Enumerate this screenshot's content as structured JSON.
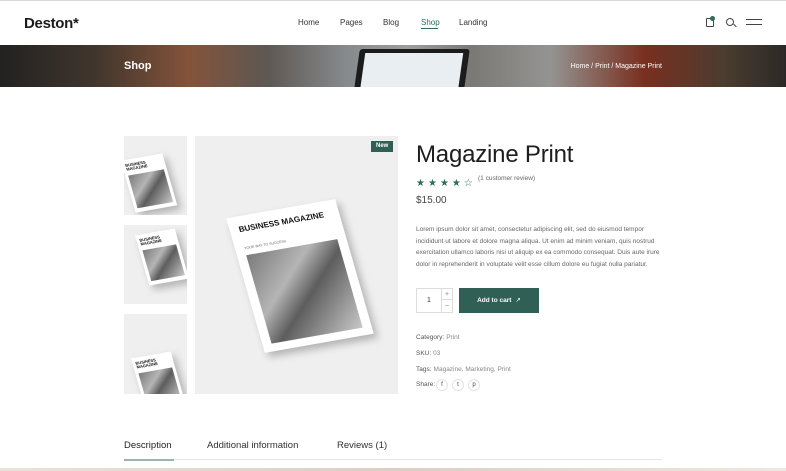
{
  "header": {
    "logo": "Deston*",
    "nav": [
      {
        "label": "Home"
      },
      {
        "label": "Pages"
      },
      {
        "label": "Blog"
      },
      {
        "label": "Shop",
        "active": true
      },
      {
        "label": "Landing"
      }
    ],
    "icons": [
      "bag-icon",
      "search-icon",
      "menu-icon"
    ]
  },
  "banner": {
    "title": "Shop",
    "breadcrumb": "Home / Print / Magazine Print"
  },
  "gallery": {
    "badge": "New",
    "cover_title": "BUSINESS MAGAZINE",
    "cover_subtitle": "YOUR WAY TO SUCCESS"
  },
  "product": {
    "title": "Magazine Print",
    "rating": 4,
    "rating_max": 5,
    "review_count": "(1 customer review)",
    "price": "$15.00",
    "description": "Lorem ipsum dolor sit amet, consectetur adipiscing elit, sed do eiusmod tempor incididunt ut labore et dolore magna aliqua. Ut enim ad minim veniam, quis nostrud exercitation ullamco laboris nisi ut aliquip ex ea commodo consequat. Duis aute irure dolor in reprehenderit in voluptate velit esse cillum dolore eu fugiat nulla pariatur.",
    "quantity": "1",
    "qty_plus": "+",
    "qty_minus": "–",
    "add_to_cart": "Add to cart",
    "add_to_cart_arrow": "↗",
    "category_label": "Category:",
    "category_value": "Print",
    "sku_label": "SKU:",
    "sku_value": "03",
    "tags_label": "Tags:",
    "tags_value": "Magazine, Marketing, Print",
    "share_label": "Share:",
    "share_icons": [
      "f",
      "t",
      "p"
    ]
  },
  "tabs": [
    {
      "label": "Description",
      "active": true
    },
    {
      "label": "Additional information"
    },
    {
      "label": "Reviews (1)"
    }
  ],
  "colors": {
    "accent": "#2f6b5e",
    "button": "#2f5f55"
  }
}
